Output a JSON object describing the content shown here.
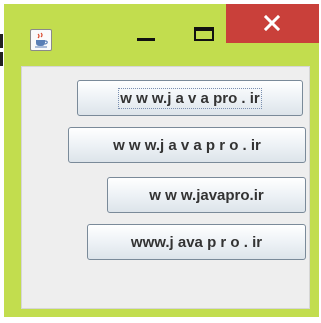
{
  "window": {
    "title_icon": "java-coffee-cup-icon",
    "controls": {
      "minimize_icon": "minimize-icon",
      "maximize_icon": "maximize-icon",
      "close_icon": "close-icon"
    },
    "frame_color": "#c2dd4e",
    "close_color": "#c9403a"
  },
  "buttons": [
    {
      "label": "w w w.j a v a pro . ir",
      "focused": true
    },
    {
      "label": "w w w.j a v a p r o . ir",
      "focused": false
    },
    {
      "label": "w w w.javapro.ir",
      "focused": false
    },
    {
      "label": "www.j ava p r o . ir",
      "focused": false
    }
  ]
}
